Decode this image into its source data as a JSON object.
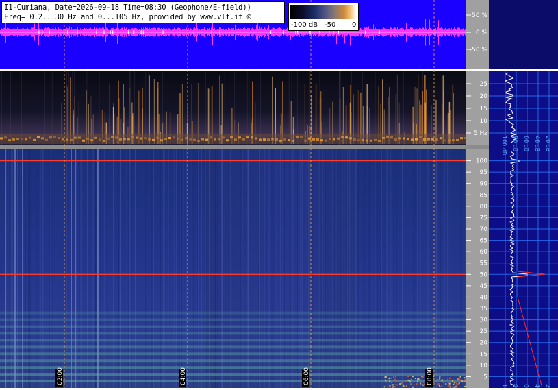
{
  "header": {
    "line1": "I1-Cumiana, Date=2026-09-18 Time=08:30 (Geophone/E-field))",
    "line2": "Freq= 0.2...30 Hz and 0...105 Hz, provided by www.vlf.it ©"
  },
  "colorbar": {
    "labels": [
      "-100 dB",
      "-50",
      "0"
    ]
  },
  "chart_data": [
    {
      "type": "line",
      "name": "amplitude",
      "ylabel_ticks": [
        "50 %",
        "0 %",
        "-50 %"
      ],
      "ylim": [
        -100,
        100
      ],
      "colors": {
        "background": "#1a00ff",
        "trace": "#ff33ff",
        "marker": "#ffffff"
      }
    },
    {
      "type": "heatmap",
      "name": "spectrogram-0-30Hz",
      "ytick_labels": [
        "25",
        "20",
        "15",
        "10",
        "5 Hz"
      ],
      "ylim": [
        0.2,
        30
      ],
      "spectrum_axis_labels": [
        "100 dB",
        "80 dB",
        "60 dB",
        "40 dB",
        "20 dB"
      ]
    },
    {
      "type": "heatmap",
      "name": "spectrogram-0-105Hz",
      "ytick_labels": [
        "100",
        "95",
        "90",
        "85",
        "80",
        "75",
        "70",
        "65",
        "60",
        "55",
        "50",
        "45",
        "40",
        "35",
        "30",
        "25",
        "20",
        "15",
        "10",
        "5"
      ],
      "ylim": [
        0,
        105
      ],
      "xtick_labels": [
        "02:00",
        "04:00",
        "06:00",
        "08:00"
      ],
      "spectrum_axis_labels": [
        "100 dB",
        "80 dB",
        "60 dB",
        "40 dB",
        "20 dB"
      ],
      "highlighted_lines_hz": [
        50,
        100
      ]
    }
  ]
}
